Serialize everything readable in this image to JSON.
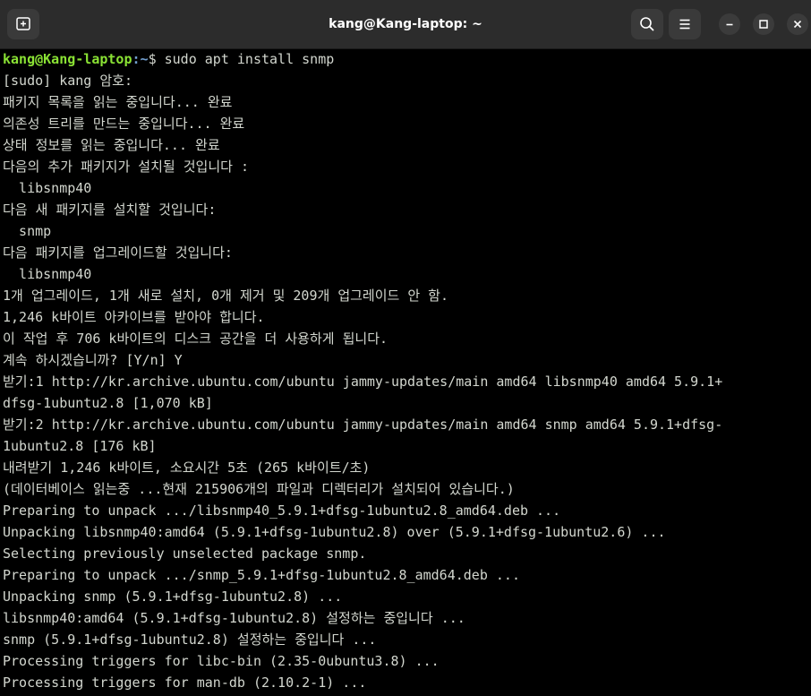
{
  "window": {
    "title": "kang@Kang-laptop: ~"
  },
  "colors": {
    "titlebar": "#2c2c2c",
    "terminal_bg": "#000000",
    "text": "#d3d7cf",
    "prompt_user": "#8ae234",
    "prompt_path": "#729fcf"
  },
  "icons": {
    "new_tab": "new-tab-icon",
    "search": "search-icon",
    "menu": "hamburger-menu-icon",
    "minimize": "minimize-icon",
    "maximize": "maximize-icon",
    "close": "close-icon"
  },
  "prompt": {
    "user_host": "kang@Kang-laptop",
    "path_suffix": ":~",
    "symbol": "$ ",
    "command": "sudo apt install snmp"
  },
  "output": [
    "[sudo] kang 암호:",
    "패키지 목록을 읽는 중입니다... 완료",
    "의존성 트리를 만드는 중입니다... 완료",
    "상태 정보를 읽는 중입니다... 완료",
    "다음의 추가 패키지가 설치될 것입니다 :",
    "  libsnmp40",
    "다음 새 패키지를 설치할 것입니다:",
    "  snmp",
    "다음 패키지를 업그레이드할 것입니다:",
    "  libsnmp40",
    "1개 업그레이드, 1개 새로 설치, 0개 제거 및 209개 업그레이드 안 함.",
    "1,246 k바이트 아카이브를 받아야 합니다.",
    "이 작업 후 706 k바이트의 디스크 공간을 더 사용하게 됩니다.",
    "계속 하시겠습니까? [Y/n] Y",
    "받기:1 http://kr.archive.ubuntu.com/ubuntu jammy-updates/main amd64 libsnmp40 amd64 5.9.1+",
    "dfsg-1ubuntu2.8 [1,070 kB]",
    "받기:2 http://kr.archive.ubuntu.com/ubuntu jammy-updates/main amd64 snmp amd64 5.9.1+dfsg-",
    "1ubuntu2.8 [176 kB]",
    "내려받기 1,246 k바이트, 소요시간 5초 (265 k바이트/초)",
    "(데이터베이스 읽는중 ...현재 215906개의 파일과 디렉터리가 설치되어 있습니다.)",
    "Preparing to unpack .../libsnmp40_5.9.1+dfsg-1ubuntu2.8_amd64.deb ...",
    "Unpacking libsnmp40:amd64 (5.9.1+dfsg-1ubuntu2.8) over (5.9.1+dfsg-1ubuntu2.6) ...",
    "Selecting previously unselected package snmp.",
    "Preparing to unpack .../snmp_5.9.1+dfsg-1ubuntu2.8_amd64.deb ...",
    "Unpacking snmp (5.9.1+dfsg-1ubuntu2.8) ...",
    "libsnmp40:amd64 (5.9.1+dfsg-1ubuntu2.8) 설정하는 중입니다 ...",
    "snmp (5.9.1+dfsg-1ubuntu2.8) 설정하는 중입니다 ...",
    "Processing triggers for libc-bin (2.35-0ubuntu3.8) ...",
    "Processing triggers for man-db (2.10.2-1) ..."
  ]
}
